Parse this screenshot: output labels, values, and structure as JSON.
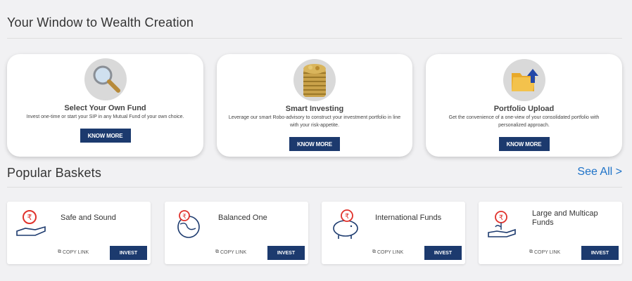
{
  "header": {
    "title": "Your Window to Wealth Creation"
  },
  "features": [
    {
      "icon": "magnifier-icon",
      "title": "Select Your Own Fund",
      "description": "Invest one-time or start your SIP in any Mutual Fund of your own choice.",
      "button": "KNOW MORE"
    },
    {
      "icon": "coins-stack-icon",
      "title": "Smart Investing",
      "description": "Leverage our smart Robo-advisory to construct your investment portfolio in line with your risk-appetite.",
      "button": "KNOW MORE"
    },
    {
      "icon": "folder-upload-icon",
      "title": "Portfolio Upload",
      "description": "Get the convenience of a one-view of your consolidated portfolio with personalized approach.",
      "button": "KNOW MORE"
    }
  ],
  "baskets_section": {
    "title": "Popular Baskets",
    "see_all": "See All >"
  },
  "baskets": [
    {
      "icon": "rupee-hand-icon",
      "name": "Safe and Sound",
      "copy_link": "COPY LINK",
      "invest": "INVEST"
    },
    {
      "icon": "rupee-globe-icon",
      "name": "Balanced One",
      "copy_link": "COPY LINK",
      "invest": "INVEST"
    },
    {
      "icon": "piggy-bank-icon",
      "name": "International Funds",
      "copy_link": "COPY LINK",
      "invest": "INVEST"
    },
    {
      "icon": "rupee-hand-plant-icon",
      "name": "Large and Multicap Funds",
      "copy_link": "COPY LINK",
      "invest": "INVEST"
    }
  ],
  "colors": {
    "accent": "#1c3a6e",
    "link": "#1d72c8",
    "icon_red": "#e0312b",
    "icon_blue": "#1c3a6e"
  }
}
